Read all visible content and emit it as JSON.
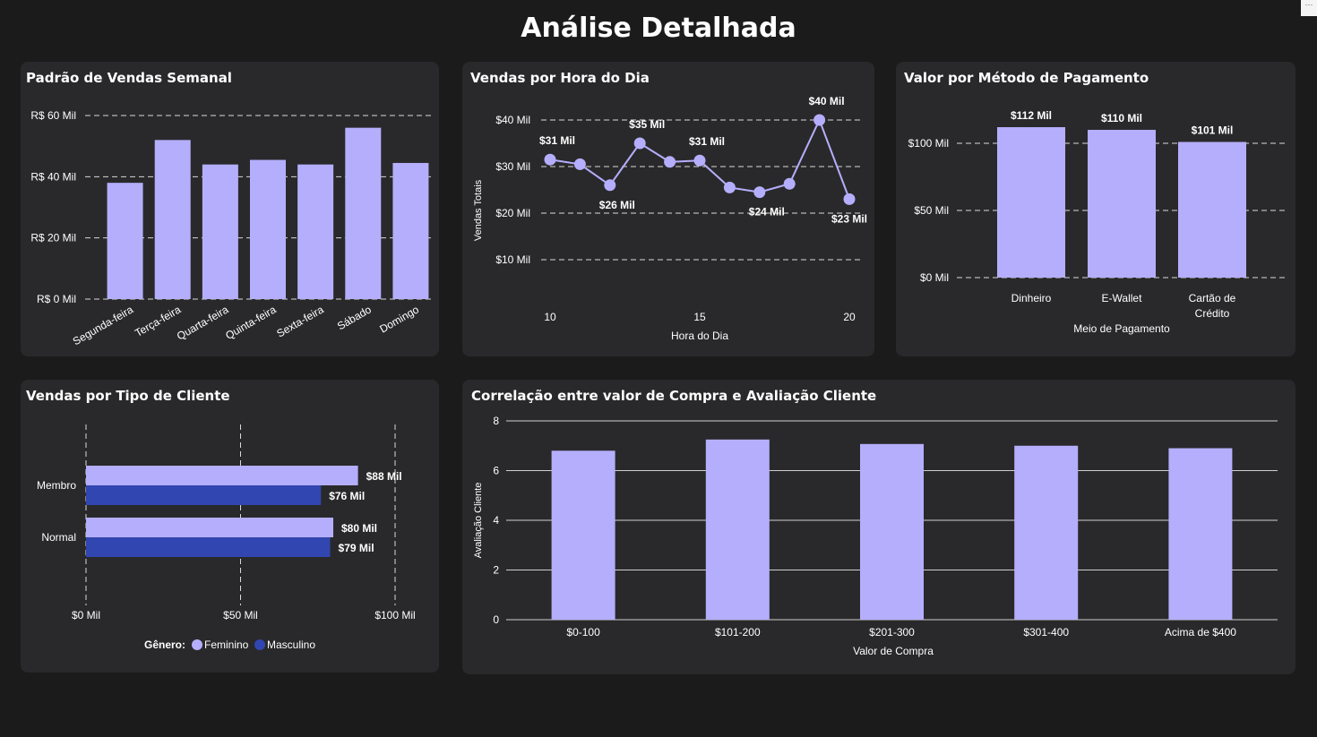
{
  "page": {
    "title": "Análise Detalhada"
  },
  "colors": {
    "background": "#1b1b1c",
    "card": "#29292b",
    "bar": "#b5aefc",
    "masculino": "#3146b0",
    "grid": "#d9d9d9"
  },
  "weekly": {
    "title": "Padrão de Vendas Semanal",
    "chart_data": {
      "type": "bar",
      "categories": [
        "Segunda-feira",
        "Terça-feira",
        "Quarta-feira",
        "Quinta-feira",
        "Sexta-feira",
        "Sábado",
        "Domingo"
      ],
      "values": [
        38,
        52,
        44,
        45.5,
        44,
        56,
        44.5
      ],
      "yticks": [
        0,
        20,
        40,
        60
      ],
      "ytick_labels": [
        "R$ 0 Mil",
        "R$ 20 Mil",
        "R$ 40 Mil",
        "R$ 60 Mil"
      ],
      "ylim": [
        0,
        60
      ],
      "grid": true
    }
  },
  "hourly": {
    "title": "Vendas por Hora do Dia",
    "chart_data": {
      "type": "line",
      "x": [
        10,
        11,
        12,
        13,
        14,
        15,
        16,
        17,
        18,
        19,
        20
      ],
      "values": [
        31.5,
        30.5,
        26,
        35,
        31,
        31.3,
        25.5,
        24.5,
        26.3,
        40,
        23
      ],
      "point_labels": [
        "$31 Mil",
        "",
        "$26 Mil",
        "$35 Mil",
        "",
        "$31 Mil",
        "",
        "$24 Mil",
        "",
        "$40 Mil",
        "$23 Mil"
      ],
      "xticks": [
        10,
        15,
        20
      ],
      "yticks": [
        10,
        20,
        30,
        40
      ],
      "ytick_labels": [
        "$10 Mil",
        "$20 Mil",
        "$30 Mil",
        "$40 Mil"
      ],
      "xlabel": "Hora do Dia",
      "ylabel": "Vendas Totais",
      "ylim": [
        0,
        40
      ],
      "grid": true
    }
  },
  "payment": {
    "title": "Valor por Método de Pagamento",
    "chart_data": {
      "type": "bar",
      "categories": [
        "Dinheiro",
        "E-Wallet",
        "Cartão de Crédito"
      ],
      "category_lines": [
        [
          "Dinheiro"
        ],
        [
          "E-Wallet"
        ],
        [
          "Cartão de",
          "Crédito"
        ]
      ],
      "values": [
        112,
        110,
        101
      ],
      "data_labels": [
        "$112 Mil",
        "$110 Mil",
        "$101 Mil"
      ],
      "yticks": [
        0,
        50,
        100
      ],
      "ytick_labels": [
        "$0 Mil",
        "$50 Mil",
        "$100 Mil"
      ],
      "xlabel": "Meio de Pagamento",
      "ylim": [
        0,
        100
      ],
      "grid": true
    }
  },
  "customer": {
    "title": "Vendas por Tipo de Cliente",
    "chart_data": {
      "type": "bar",
      "orientation": "horizontal",
      "categories": [
        "Membro",
        "Normal"
      ],
      "series": [
        {
          "name": "Feminino",
          "values": [
            88,
            80
          ],
          "labels": [
            "$88 Mil",
            "$80 Mil"
          ],
          "color": "#b5aefc"
        },
        {
          "name": "Masculino",
          "values": [
            76,
            79
          ],
          "labels": [
            "$76 Mil",
            "$79 Mil"
          ],
          "color": "#3146b0"
        }
      ],
      "xticks": [
        0,
        50,
        100
      ],
      "xtick_labels": [
        "$0 Mil",
        "$50 Mil",
        "$100 Mil"
      ],
      "xlim": [
        0,
        100
      ],
      "legend_title": "Gênero:",
      "legend_position": "bottom",
      "grid": true
    }
  },
  "correlation": {
    "title": "Correlação entre valor de Compra e Avaliação Cliente",
    "chart_data": {
      "type": "bar",
      "categories": [
        "$0-100",
        "$101-200",
        "$201-300",
        "$301-400",
        "Acima de $400"
      ],
      "values": [
        6.8,
        7.25,
        7.07,
        7.0,
        6.9
      ],
      "yticks": [
        0,
        2,
        4,
        6,
        8
      ],
      "ytick_labels": [
        "0",
        "2",
        "4",
        "6",
        "8"
      ],
      "xlabel": "Valor de Compra",
      "ylabel": "Avaliação Cliente",
      "ylim": [
        0,
        8
      ],
      "grid": true
    }
  }
}
